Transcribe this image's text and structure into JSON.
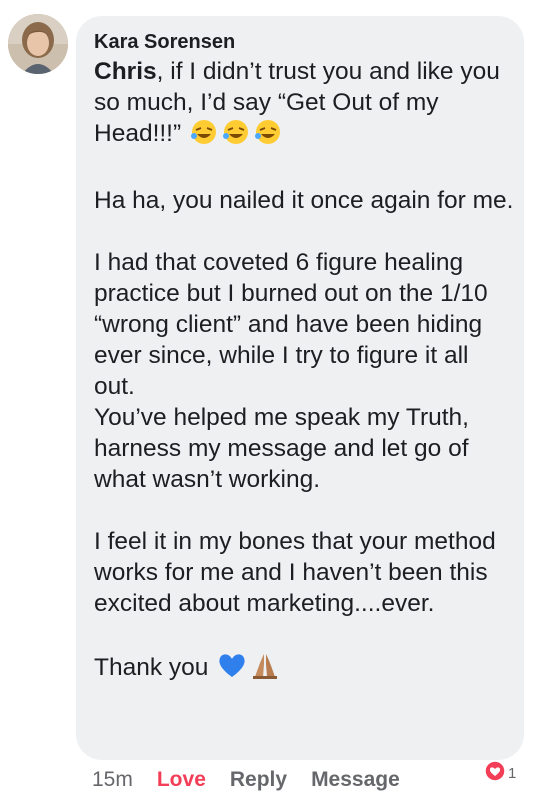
{
  "comment": {
    "author": "Kara Sorensen",
    "mention": "Chris",
    "line1_rest": ", if I didn’t trust you and like you so much, I’d say “Get Out of my Head!!!”",
    "laugh_emojis": "🤣🤣🤣",
    "para2": "Ha ha, you nailed it once again for me.",
    "para3": "I had that coveted 6 figure healing practice but I burned out on the 1/10 “wrong client” and have been hiding ever since, while I try to figure it all out.",
    "para4": "You’ve helped me speak my Truth, harness my message and let go of what wasn’t working.",
    "para5": "I feel it in my bones that your method works for me and I haven’t been this excited about marketing....ever.",
    "para6_text": "Thank you",
    "para6_emojis": "💙🙏🏽"
  },
  "actions": {
    "time": "15m",
    "love_label": "Love",
    "reply_label": "Reply",
    "message_label": "Message"
  },
  "reactions": {
    "icon": "heart-reaction-icon",
    "count": "1"
  },
  "colors": {
    "bubble_bg": "#eff0f2",
    "love": "#f33e58",
    "meta": "#65676b",
    "text": "#1c1e21"
  }
}
